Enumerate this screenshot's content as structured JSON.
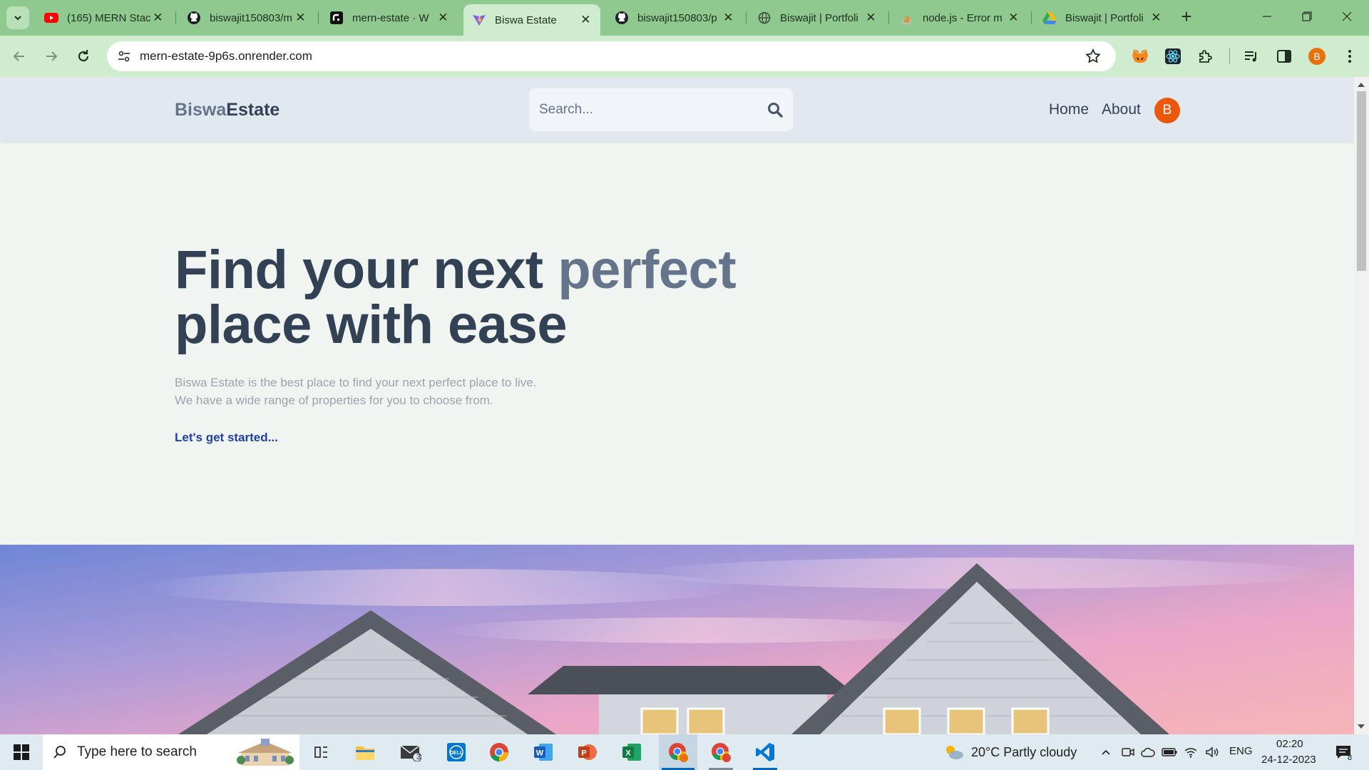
{
  "browser": {
    "tabs": [
      {
        "title": "(165) MERN Stac",
        "icon": "youtube-icon",
        "active": false
      },
      {
        "title": "biswajit150803/m",
        "icon": "github-icon",
        "active": false
      },
      {
        "title": "mern-estate · W",
        "icon": "render-icon",
        "active": false
      },
      {
        "title": "Biswa Estate",
        "icon": "vite-icon",
        "active": true
      },
      {
        "title": "biswajit150803/p",
        "icon": "github-icon",
        "active": false
      },
      {
        "title": "Biswajit | Portfoli",
        "icon": "globe-icon",
        "active": false
      },
      {
        "title": "node.js - Error m",
        "icon": "stackoverflow-icon",
        "active": false
      },
      {
        "title": "Biswajit | Portfoli",
        "icon": "drive-icon",
        "active": false
      }
    ],
    "url": "mern-estate-9p6s.onrender.com",
    "profile_initial": "B",
    "colors": {
      "frame": "#8fc98f",
      "toolbar": "#cfeccf"
    }
  },
  "site": {
    "logo_part1": "Biswa",
    "logo_part2": "Estate",
    "search_placeholder": "Search...",
    "nav": {
      "home": "Home",
      "about": "About"
    },
    "avatar_initial": "B",
    "hero": {
      "title_part1": "Find your next",
      "title_accent": "perfect",
      "title_line2": "place with ease",
      "desc_line1": "Biswa Estate is the best place to find your next perfect place to live.",
      "desc_line2": "We have a wide range of properties for you to choose from.",
      "cta": "Let's get started..."
    },
    "colors": {
      "header": "#e2e8f0",
      "title": "#334155",
      "accent": "#64748b",
      "cta": "#1e40af",
      "avatar": "#ea580c"
    }
  },
  "taskbar": {
    "search_placeholder": "Type here to search",
    "mail_badge": "3",
    "weather": "20°C  Partly cloudy",
    "language": "ENG",
    "time": "02:20",
    "date": "24-12-2023",
    "notification_count": "8"
  }
}
